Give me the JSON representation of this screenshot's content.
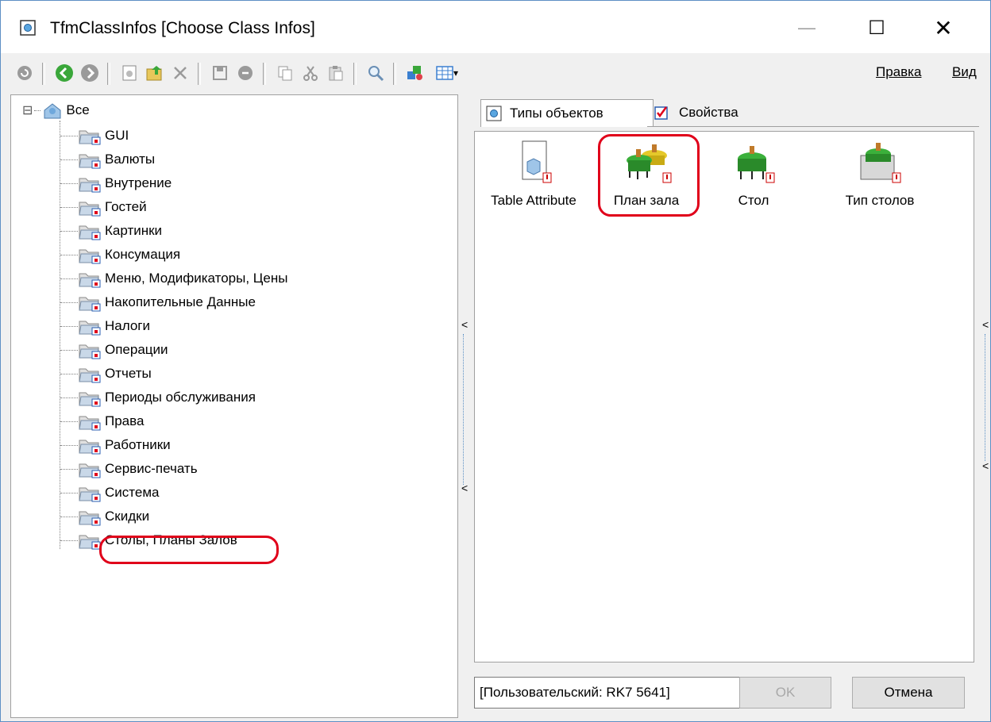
{
  "window": {
    "title": "TfmClassInfos [Choose Class Infos]",
    "minimize_glyph": "—",
    "maximize_glyph": "☐",
    "close_glyph": "✕"
  },
  "toolbar": {
    "tools": [
      "refresh-icon",
      "back-icon",
      "forward-icon",
      "new-icon",
      "up-folder-icon",
      "delete-icon",
      "save-icon",
      "revert-icon",
      "copy-icon",
      "cut-icon",
      "paste-icon",
      "find-icon",
      "paint-icon",
      "grid-view-icon"
    ],
    "menu_edit": "Правка",
    "menu_view": "Вид",
    "dropdown_glyph": "▾"
  },
  "tree": {
    "root_label": "Все",
    "expander": "⊟",
    "items": [
      "GUI",
      "Валюты",
      "Внутрение",
      "Гостей",
      "Картинки",
      "Консумация",
      "Меню, Модификаторы, Цены",
      "Накопительные Данные",
      "Налоги",
      "Операции",
      "Отчеты",
      "Периоды обслуживания",
      "Права",
      "Работники",
      "Сервис-печать",
      "Система",
      "Скидки",
      "Столы, Планы Залов"
    ]
  },
  "tabs": {
    "objects": "Типы объектов",
    "properties": "Свойства"
  },
  "objects": [
    {
      "label": "Table Attribute",
      "icon": "cube-page-icon"
    },
    {
      "label": "План зала",
      "icon": "hall-plan-icon"
    },
    {
      "label": "Стол",
      "icon": "table-icon"
    },
    {
      "label": "Тип столов",
      "icon": "table-type-icon"
    }
  ],
  "footer": {
    "combo_value": "[Пользовательский: RK7 5641]",
    "ok_label": "OK",
    "cancel_label": "Отмена"
  },
  "splitter_glyph": "<"
}
